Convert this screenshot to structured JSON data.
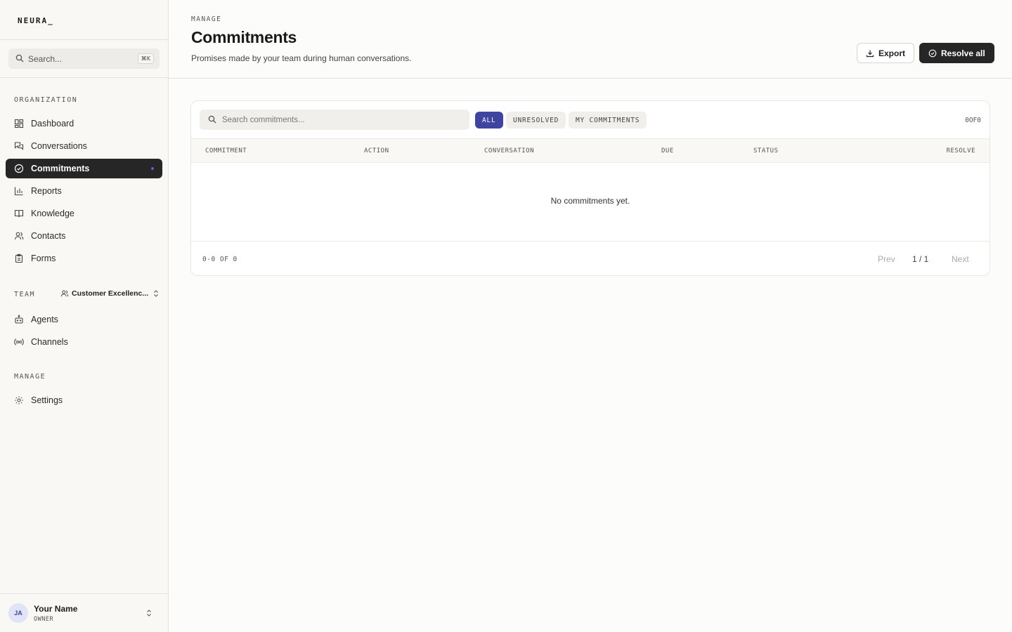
{
  "brand": {
    "name": "NEURA_"
  },
  "sidebar": {
    "search_placeholder": "Search...",
    "search_shortcut": "⌘K",
    "org_label": "ORGANIZATION",
    "org_items": [
      {
        "label": "Dashboard",
        "icon": "dashboard-icon"
      },
      {
        "label": "Conversations",
        "icon": "conversations-icon"
      },
      {
        "label": "Commitments",
        "icon": "check-circle-icon",
        "active": true
      },
      {
        "label": "Reports",
        "icon": "bar-chart-icon"
      },
      {
        "label": "Knowledge",
        "icon": "book-icon"
      },
      {
        "label": "Contacts",
        "icon": "users-icon"
      },
      {
        "label": "Forms",
        "icon": "clipboard-icon"
      }
    ],
    "team_label": "TEAM",
    "team_name": "Customer Excellenc...",
    "team_items": [
      {
        "label": "Agents",
        "icon": "bot-icon"
      },
      {
        "label": "Channels",
        "icon": "broadcast-icon"
      }
    ],
    "manage_label": "MANAGE",
    "manage_items": [
      {
        "label": "Settings",
        "icon": "gear-icon"
      }
    ],
    "user": {
      "initials": "JA",
      "name": "Your Name",
      "role": "OWNER"
    }
  },
  "header": {
    "eyebrow": "MANAGE",
    "title": "Commitments",
    "subtitle": "Promises made by your team during human conversations.",
    "export_label": "Export",
    "resolve_label": "Resolve all"
  },
  "table": {
    "search_placeholder": "Search commitments...",
    "filters": [
      {
        "label": "ALL",
        "active": true
      },
      {
        "label": "UNRESOLVED",
        "active": false
      },
      {
        "label": "MY COMMITMENTS",
        "active": false
      }
    ],
    "count_tag": "0OF0",
    "columns": [
      "COMMITMENT",
      "ACTION",
      "CONVERSATION",
      "DUE",
      "STATUS",
      "RESOLVE"
    ],
    "empty_message": "No commitments yet.",
    "range": "0-0 OF 0",
    "prev_label": "Prev",
    "page": "1 / 1",
    "next_label": "Next"
  },
  "colors": {
    "accent": "#3e44a0",
    "dark": "#262626",
    "background": "#fcfcfa"
  }
}
